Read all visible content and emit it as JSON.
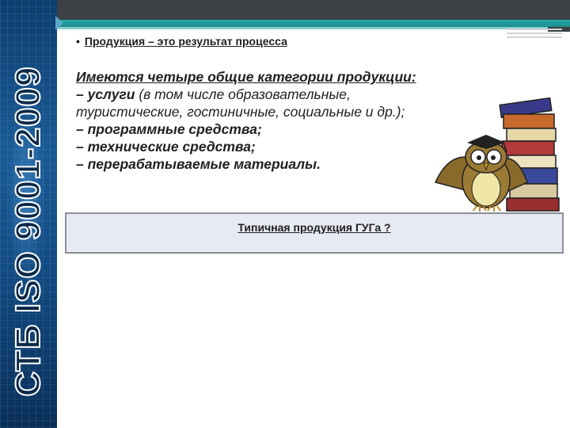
{
  "sidebar": {
    "vertical_title": "СТБ ISO 9001-2009"
  },
  "slide": {
    "heading_bullet": "•",
    "heading": "Продукция – это результат процесса",
    "intro": "Имеются четыре общие категории продукции:",
    "items": [
      {
        "lead": "– услуги",
        "rest": " (в том числе образовательные, туристические, гостиничные, социальные и др.);"
      },
      {
        "lead": "– программные средства;",
        "rest": ""
      },
      {
        "lead": "– технические средства;",
        "rest": ""
      },
      {
        "lead": "– перерабатываемые материалы.",
        "rest": ""
      }
    ],
    "question": "Типичная продукция ГУГа ?"
  },
  "colors": {
    "topbar": "#3c4146",
    "accent": "#23a7a8",
    "sidebar": "#124a80",
    "box_bg": "#e7eaf2"
  },
  "icons": [
    "owl-with-books-clipart"
  ]
}
